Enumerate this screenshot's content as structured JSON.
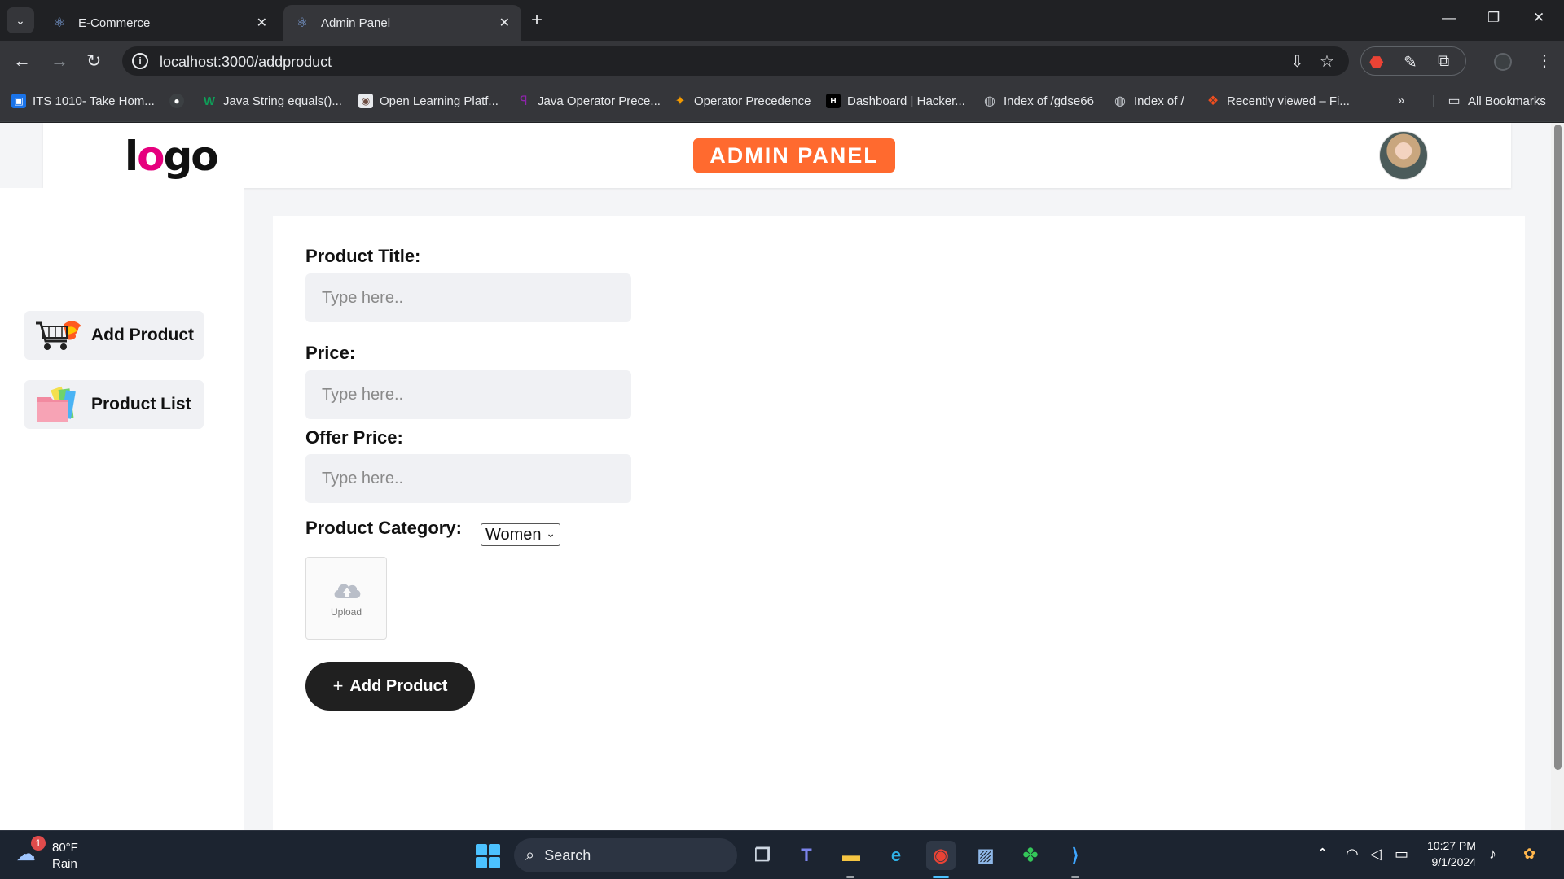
{
  "browser": {
    "tabs": [
      {
        "title": "E-Commerce",
        "active": false
      },
      {
        "title": "Admin Panel",
        "active": true
      }
    ],
    "url": "localhost:3000/addproduct",
    "bookmarks": [
      {
        "label": "ITS 1010- Take Hom...",
        "icon": "classroom-icon",
        "color": "#1a73e8"
      },
      {
        "label": "",
        "icon": "github-icon",
        "color": "#3c4043"
      },
      {
        "label": "Java String equals()...",
        "icon": "w3-icon",
        "color": "#0f9d58"
      },
      {
        "label": "Open Learning Platf...",
        "icon": "ol-icon",
        "color": "#e8eaed"
      },
      {
        "label": "Java Operator Prece...",
        "icon": "oracle-icon",
        "color": "#8e24aa"
      },
      {
        "label": "Operator Precedence",
        "icon": "book-icon",
        "color": "#f29900"
      },
      {
        "label": "Dashboard | Hacker...",
        "icon": "hackerrank-icon",
        "color": "#000000"
      },
      {
        "label": "Index of /gdse66",
        "icon": "globe-icon",
        "color": "#5f6368"
      },
      {
        "label": "Index of /",
        "icon": "globe-icon",
        "color": "#5f6368"
      },
      {
        "label": "Recently viewed – Fi...",
        "icon": "figma-icon",
        "color": "#f24e1e"
      }
    ],
    "all_bookmarks": "All Bookmarks"
  },
  "page": {
    "logo": {
      "text_a": "l",
      "text_o1": "o",
      "text_rest": "go"
    },
    "badge": "ADMIN PANEL",
    "sidebar": [
      {
        "label": "Add Product",
        "icon": "cart-icon"
      },
      {
        "label": "Product List",
        "icon": "folder-icon"
      }
    ],
    "form": {
      "title_label": "Product Title:",
      "title_placeholder": "Type here..",
      "price_label": "Price:",
      "price_placeholder": "Type here..",
      "offer_label": "Offer Price:",
      "offer_placeholder": "Type here..",
      "category_label": "Product Category:",
      "category_value": "Women",
      "upload_label": "Upload",
      "submit_label": "Add Product"
    }
  },
  "taskbar": {
    "weather_temp": "80°F",
    "weather_cond": "Rain",
    "weather_badge": "1",
    "search": "Search",
    "time": "10:27 PM",
    "date": "9/1/2024"
  }
}
